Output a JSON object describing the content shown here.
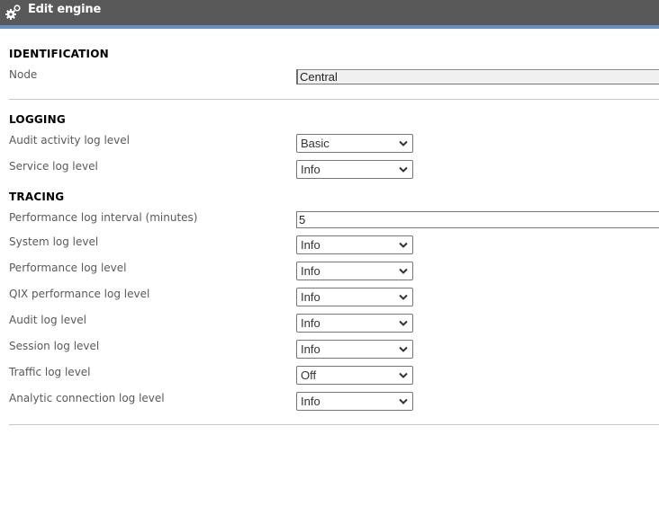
{
  "header": {
    "title": "Edit engine",
    "icon": "gears-icon"
  },
  "colors": {
    "header_bg": "#595959",
    "accent": "#6591c0",
    "divider": "#c8c8c8"
  },
  "identification": {
    "title": "IDENTIFICATION",
    "node_label": "Node",
    "node_value": "Central"
  },
  "logging": {
    "title": "LOGGING",
    "fields": [
      {
        "label": "Audit activity log level",
        "value": "Basic"
      },
      {
        "label": "Service log level",
        "value": "Info"
      }
    ]
  },
  "tracing": {
    "title": "TRACING",
    "interval_label": "Performance log interval (minutes)",
    "interval_value": "5",
    "fields": [
      {
        "label": "System log level",
        "value": "Info"
      },
      {
        "label": "Performance log level",
        "value": "Info"
      },
      {
        "label": "QIX performance log level",
        "value": "Info"
      },
      {
        "label": "Audit log level",
        "value": "Info"
      },
      {
        "label": "Session log level",
        "value": "Info"
      },
      {
        "label": "Traffic log level",
        "value": "Off"
      },
      {
        "label": "Analytic connection log level",
        "value": "Info"
      }
    ]
  }
}
